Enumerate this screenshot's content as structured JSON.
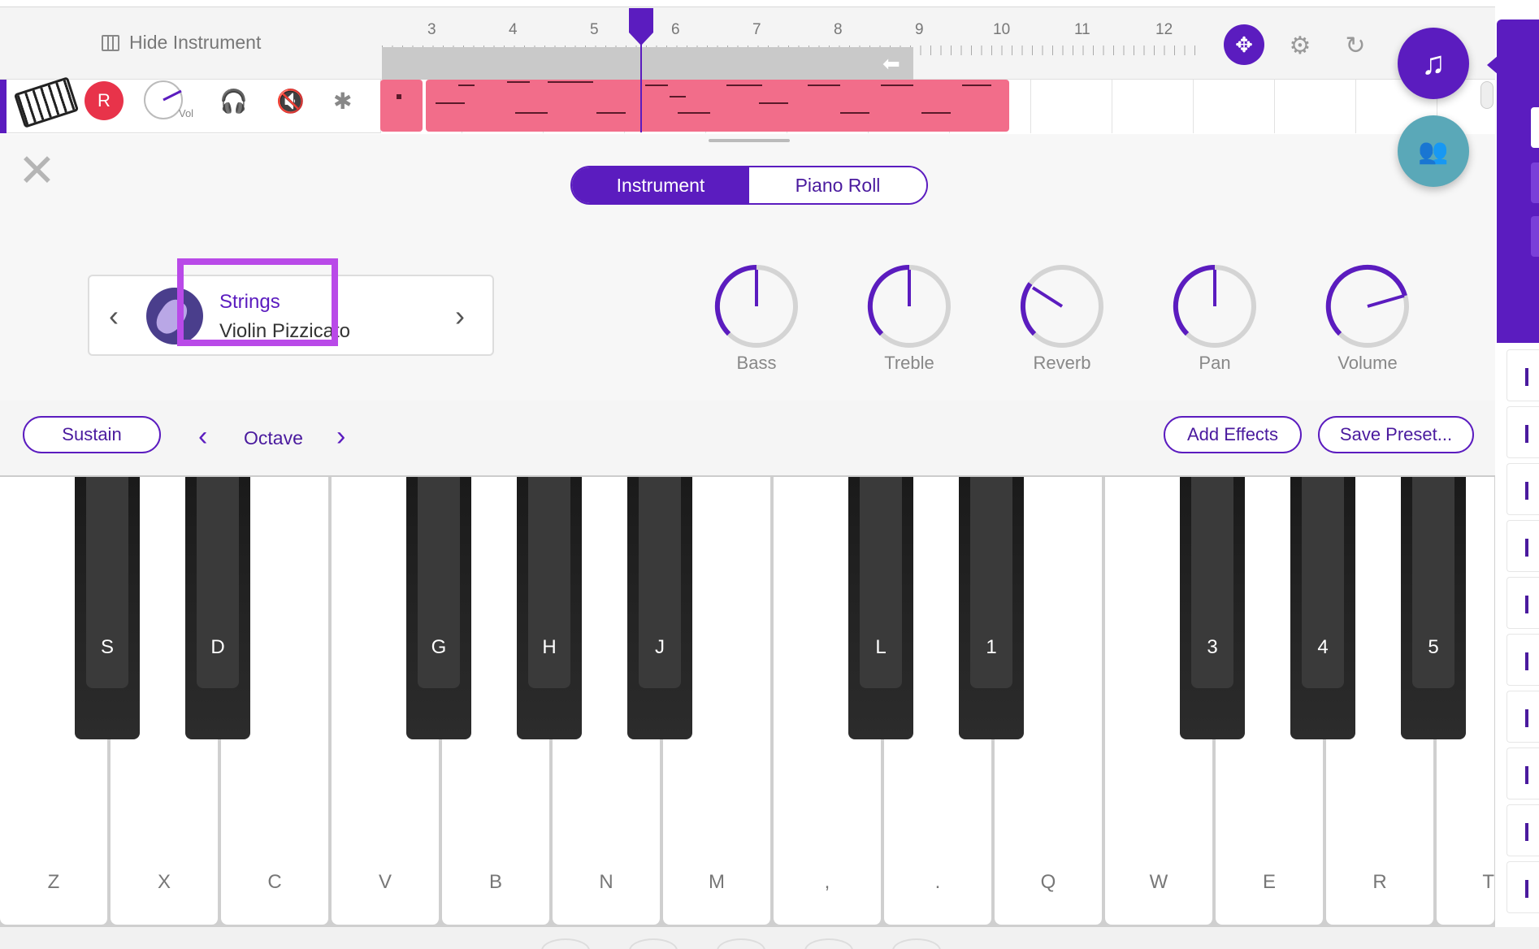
{
  "topbar": {
    "hide_instrument_label": "Hide Instrument",
    "ruler_numbers": [
      "3",
      "4",
      "5",
      "6",
      "7",
      "8",
      "9",
      "10",
      "11",
      "12"
    ]
  },
  "track": {
    "record_label": "R",
    "vol_label": "Vol"
  },
  "tabs": {
    "instrument": "Instrument",
    "piano_roll": "Piano Roll",
    "active": "Instrument"
  },
  "preset": {
    "name": "Strings",
    "subname": "Violin Pizzicato"
  },
  "knobs": [
    {
      "label": "Bass"
    },
    {
      "label": "Treble"
    },
    {
      "label": "Reverb"
    },
    {
      "label": "Pan"
    },
    {
      "label": "Volume"
    }
  ],
  "controls": {
    "sustain": "Sustain",
    "octave": "Octave",
    "add_effects": "Add Effects",
    "save_preset": "Save Preset..."
  },
  "white_keys": [
    "Z",
    "X",
    "C",
    "V",
    "B",
    "N",
    "M",
    ",",
    ".",
    "Q",
    "W",
    "E",
    "R",
    "T"
  ],
  "black_keys": [
    "S",
    "D",
    "G",
    "H",
    "J",
    "L",
    "1",
    "3",
    "4",
    "5"
  ],
  "colors": {
    "accent": "#5b1cbf",
    "clip": "#f26d8a",
    "record": "#e8334a",
    "collab": "#5aa8b8",
    "highlight": "#b94ae8"
  },
  "icons": {
    "hide_instrument": "keyboard-icon",
    "move": "move-arrows-icon",
    "settings": "gear-icon",
    "sync": "sync-icon",
    "music": "music-note-icon",
    "collaborate": "people-icon"
  }
}
